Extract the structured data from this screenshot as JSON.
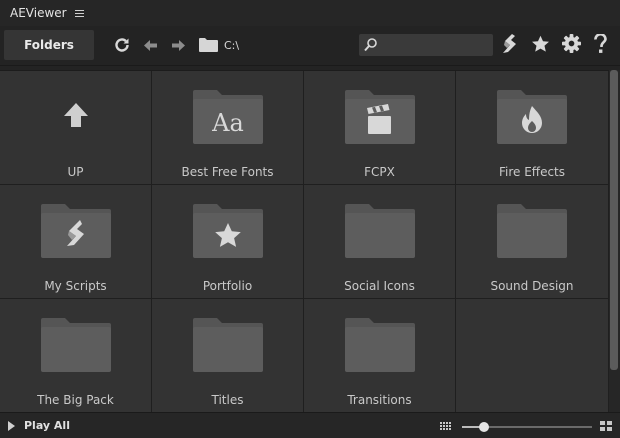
{
  "app": {
    "title": "AEViewer"
  },
  "toolbar": {
    "folders_label": "Folders",
    "path": "C:\\",
    "search": {
      "value": "",
      "placeholder": ""
    }
  },
  "folders": [
    {
      "label": "UP",
      "icon": "up-arrow-icon"
    },
    {
      "label": "Best Free Fonts",
      "icon": "font-aa-icon"
    },
    {
      "label": "FCPX",
      "icon": "clapperboard-icon"
    },
    {
      "label": "Fire Effects",
      "icon": "flame-icon"
    },
    {
      "label": "My Scripts",
      "icon": "script-icon"
    },
    {
      "label": "Portfolio",
      "icon": "star-icon"
    },
    {
      "label": "Social Icons",
      "icon": "folder-icon"
    },
    {
      "label": "Sound Design",
      "icon": "folder-icon"
    },
    {
      "label": "The Big Pack",
      "icon": "folder-icon"
    },
    {
      "label": "Titles",
      "icon": "folder-icon"
    },
    {
      "label": "Transitions",
      "icon": "folder-icon"
    }
  ],
  "footer": {
    "play_all_label": "Play All",
    "zoom_fraction": 0.17
  },
  "colors": {
    "background": "#232323",
    "tile": "#333333",
    "folder": "#5d5d5d",
    "folder_tab": "#555555",
    "emblem": "#d8d8d8"
  }
}
